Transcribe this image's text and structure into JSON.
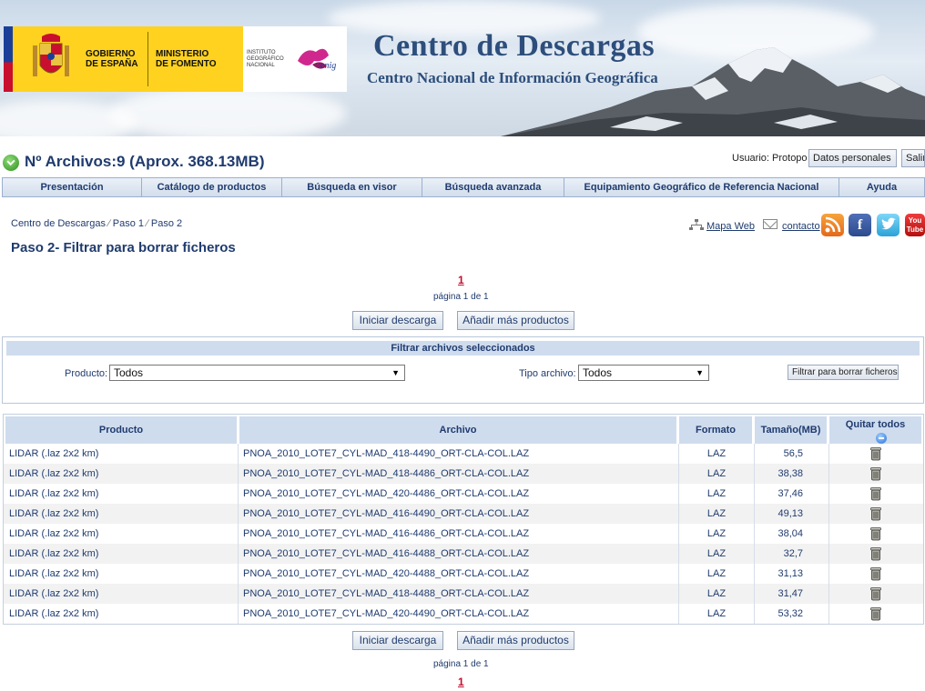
{
  "banner": {
    "title": "Centro de Descargas",
    "subtitle": "Centro Nacional de Información Geográfica",
    "gov_label": "GOBIERNO DE ESPAÑA",
    "ministry_label": "MINISTERIO DE FOMENTO",
    "institute_label": "INSTITUTO GEOGRÁFICO NACIONAL",
    "cnig_label": "cnig"
  },
  "status": {
    "files": "Nº Archivos:9 (Aprox. 368.13MB)",
    "user": "Usuario: Protopo",
    "personal_data": "Datos personales",
    "exit": "Salir"
  },
  "nav": [
    "Presentación",
    "Catálogo de productos",
    "Búsqueda en visor",
    "Búsqueda avanzada",
    "Equipamiento Geográfico de Referencia Nacional",
    "Ayuda"
  ],
  "breadcrumb": [
    "Centro de Descargas",
    "Paso 1",
    "Paso 2"
  ],
  "page_title": "Paso 2- Filtrar para borrar ficheros",
  "utilities": {
    "sitemap": "Mapa Web",
    "contact": "contacto"
  },
  "social": {
    "rss": "rss-icon",
    "facebook": "facebook-icon",
    "twitter": "twitter-icon",
    "youtube": "youtube-icon",
    "youtube_text": "You Tube"
  },
  "pager": {
    "page_number": "1",
    "page_info": "página 1 de 1"
  },
  "actions": {
    "start_download": "Iniciar descarga",
    "add_products": "Añadir más productos"
  },
  "filter": {
    "title": "Filtrar archivos seleccionados",
    "product_label": "Producto:",
    "product_value": "Todos",
    "type_label": "Tipo archivo:",
    "type_value": "Todos",
    "button": "Filtrar para borrar ficheros"
  },
  "table": {
    "headers": {
      "product": "Producto",
      "file": "Archivo",
      "format": "Formato",
      "size": "Tamaño(MB)",
      "remove_all": "Quitar todos"
    },
    "rows": [
      {
        "product": "LIDAR (.laz 2x2 km)",
        "file": "PNOA_2010_LOTE7_CYL-MAD_418-4490_ORT-CLA-COL.LAZ",
        "format": "LAZ",
        "size": "56,5"
      },
      {
        "product": "LIDAR (.laz 2x2 km)",
        "file": "PNOA_2010_LOTE7_CYL-MAD_418-4486_ORT-CLA-COL.LAZ",
        "format": "LAZ",
        "size": "38,38"
      },
      {
        "product": "LIDAR (.laz 2x2 km)",
        "file": "PNOA_2010_LOTE7_CYL-MAD_420-4486_ORT-CLA-COL.LAZ",
        "format": "LAZ",
        "size": "37,46"
      },
      {
        "product": "LIDAR (.laz 2x2 km)",
        "file": "PNOA_2010_LOTE7_CYL-MAD_416-4490_ORT-CLA-COL.LAZ",
        "format": "LAZ",
        "size": "49,13"
      },
      {
        "product": "LIDAR (.laz 2x2 km)",
        "file": "PNOA_2010_LOTE7_CYL-MAD_416-4486_ORT-CLA-COL.LAZ",
        "format": "LAZ",
        "size": "38,04"
      },
      {
        "product": "LIDAR (.laz 2x2 km)",
        "file": "PNOA_2010_LOTE7_CYL-MAD_416-4488_ORT-CLA-COL.LAZ",
        "format": "LAZ",
        "size": "32,7"
      },
      {
        "product": "LIDAR (.laz 2x2 km)",
        "file": "PNOA_2010_LOTE7_CYL-MAD_420-4488_ORT-CLA-COL.LAZ",
        "format": "LAZ",
        "size": "31,13"
      },
      {
        "product": "LIDAR (.laz 2x2 km)",
        "file": "PNOA_2010_LOTE7_CYL-MAD_418-4488_ORT-CLA-COL.LAZ",
        "format": "LAZ",
        "size": "31,47"
      },
      {
        "product": "LIDAR (.laz 2x2 km)",
        "file": "PNOA_2010_LOTE7_CYL-MAD_420-4490_ORT-CLA-COL.LAZ",
        "format": "LAZ",
        "size": "53,32"
      }
    ]
  }
}
